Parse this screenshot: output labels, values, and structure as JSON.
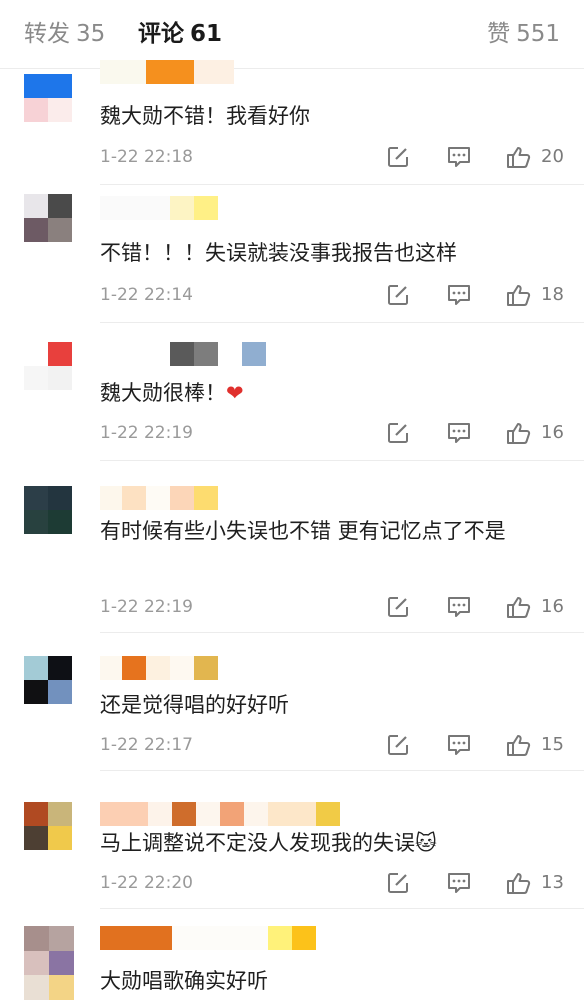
{
  "tabs": [
    {
      "label": "转发",
      "count": "35"
    },
    {
      "label": "评论",
      "count": "61"
    },
    {
      "label": "赞",
      "count": "551"
    }
  ],
  "comments": [
    {
      "text": "魏大勋不错！我看好你",
      "time": "1-22 22:18",
      "likes": "20"
    },
    {
      "text": "不错！！！失误就装没事我报告也这样",
      "time": "1-22 22:14",
      "likes": "18"
    },
    {
      "text": "魏大勋很棒！",
      "emoji": "❤",
      "time": "1-22 22:19",
      "likes": "16"
    },
    {
      "text": "有时候有些小失误也不错 更有记忆点了不是",
      "time": "1-22 22:19",
      "likes": "16"
    },
    {
      "text": "还是觉得唱的好好听",
      "time": "1-22 22:17",
      "likes": "15"
    },
    {
      "text": "马上调整说不定没人发现我的失误",
      "emoji": "🐱",
      "time": "1-22 22:20",
      "likes": "13"
    },
    {
      "text": "大勋唱歌确实好听"
    }
  ],
  "icons": {
    "edit": "edit-icon",
    "comment": "comment-icon",
    "like": "thumbs-up-icon"
  },
  "colors": {
    "text": "#1f1f1f",
    "muted": "#9a9a9a",
    "heart": "#e0302d",
    "divider": "#ececec"
  }
}
